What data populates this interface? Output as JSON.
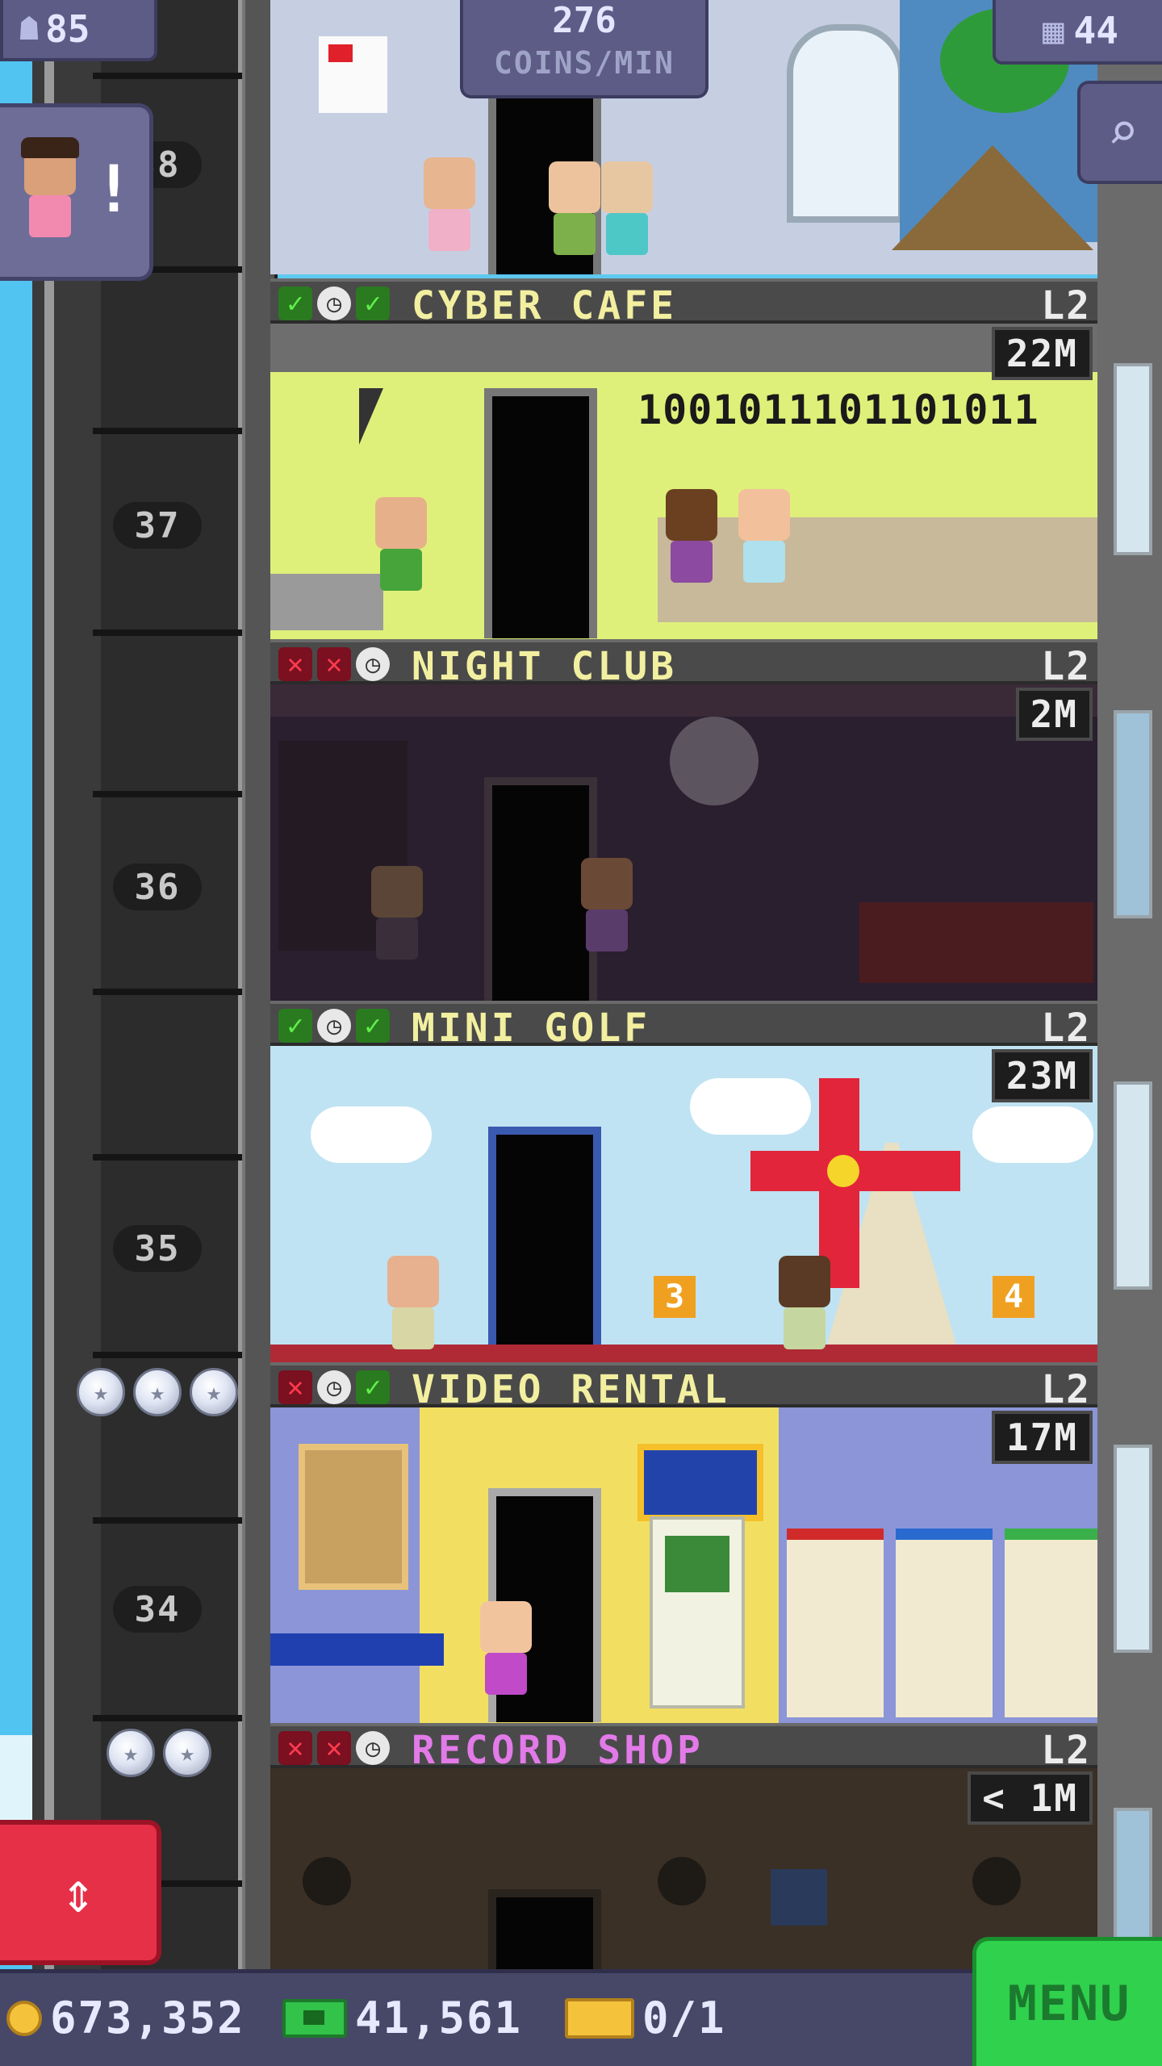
{
  "hud": {
    "population": "85",
    "coins_per_min_value": "276",
    "coins_per_min_label": "COINS/MIN",
    "floor_count": "44"
  },
  "colors": {
    "ok": "#5ff04a",
    "no": "#ff3b4f",
    "hud": "#5c5c86",
    "menu": "#2fd14d"
  },
  "icons": {
    "population": "person-icon",
    "floors": "building-icon",
    "search": "magnifier-icon",
    "elevator": "up-down-arrow-icon",
    "coins": "coin-icon",
    "bux": "tower-bux-icon",
    "tickets": "golden-ticket-icon"
  },
  "shaft": {
    "partial_number": "38",
    "floor_numbers": [
      "37",
      "36",
      "35",
      "34"
    ]
  },
  "floors": [
    {
      "name": "CYBER CAFE",
      "level": "L2",
      "earnings": "22M",
      "status": [
        "ok",
        "clock",
        "ok"
      ],
      "wall_text": "1001011101101011"
    },
    {
      "name": "NIGHT CLUB",
      "level": "L2",
      "earnings": "2M",
      "status": [
        "no",
        "no",
        "clock"
      ]
    },
    {
      "name": "MINI GOLF",
      "level": "L2",
      "earnings": "23M",
      "status": [
        "ok",
        "clock",
        "ok"
      ],
      "holes": [
        "3",
        "4"
      ]
    },
    {
      "name": "VIDEO RENTAL",
      "level": "L2",
      "earnings": "17M",
      "status": [
        "no",
        "clock",
        "ok"
      ]
    },
    {
      "name": "RECORD SHOP",
      "level": "L2",
      "earnings": "< 1M",
      "status": [
        "no",
        "no",
        "clock"
      ]
    }
  ],
  "bottom_bar": {
    "coins": "673,352",
    "bux": "41,561",
    "tickets": "0/1",
    "menu_label": "MENU"
  }
}
